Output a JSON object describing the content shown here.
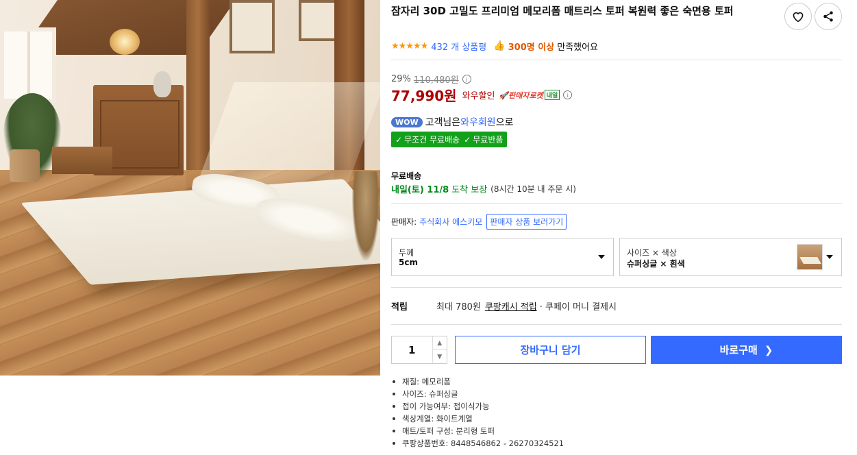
{
  "product": {
    "title": "잠자리 30D 고밀도 프리미엄 메모리폼 매트리스 토퍼 복원력 좋은 숙면용 토퍼",
    "rating_stars": "★★★★★",
    "rating_value": 4.5,
    "review_count": "432 개 상품평",
    "satisfied_icon": "👍",
    "satisfied_count": "300명 이상",
    "satisfied_text": "만족했어요"
  },
  "icons": {
    "heart": "heart-icon",
    "share": "share-icon"
  },
  "price": {
    "discount_rate": "29%",
    "origin_price": "110,480원",
    "sale_price": "77,990원",
    "wow_discount": "와우할인",
    "rocket_label": "🚀판매자로켓",
    "rocket_badge": "내일"
  },
  "wow": {
    "badge": "WOW",
    "text_prefix": "고객님은",
    "member": "와우회원",
    "text_suffix": "으로",
    "free_shipping": "무조건 무료배송",
    "free_return": "무료반품"
  },
  "shipping": {
    "label": "무료배송",
    "date": "내일(토) 11/8",
    "note": "도착 보장",
    "condition": "(8시간 10분 내 주문 시)"
  },
  "seller": {
    "label": "판매자:",
    "name": "주식회사 에스키모",
    "link": "판매자 상품 보러가기"
  },
  "options": {
    "thickness_label": "두께",
    "thickness_value": "5cm",
    "size_label": "사이즈 × 색상",
    "size_value": "슈퍼싱글 × 흰색"
  },
  "points": {
    "label": "적립",
    "text": "최대 780원",
    "link": "쿠팡캐시 적립",
    "sub": "· 쿠페이 머니 결제시"
  },
  "purchase": {
    "quantity": "1",
    "cart_label": "장바구니 담기",
    "buy_label": "바로구매"
  },
  "specs": [
    "재질: 메모리폼",
    "사이즈: 슈퍼싱글",
    "접이 가능여부: 접이식가능",
    "색상계열: 화이트계열",
    "매트/토퍼 구성: 분리형 토퍼",
    "쿠팡상품번호: 8448546862 - 26270324521"
  ],
  "colors": {
    "accent": "#346aff",
    "price_red": "#ae0000",
    "delivery_green": "#13a01b",
    "star_orange": "#ff9600"
  }
}
